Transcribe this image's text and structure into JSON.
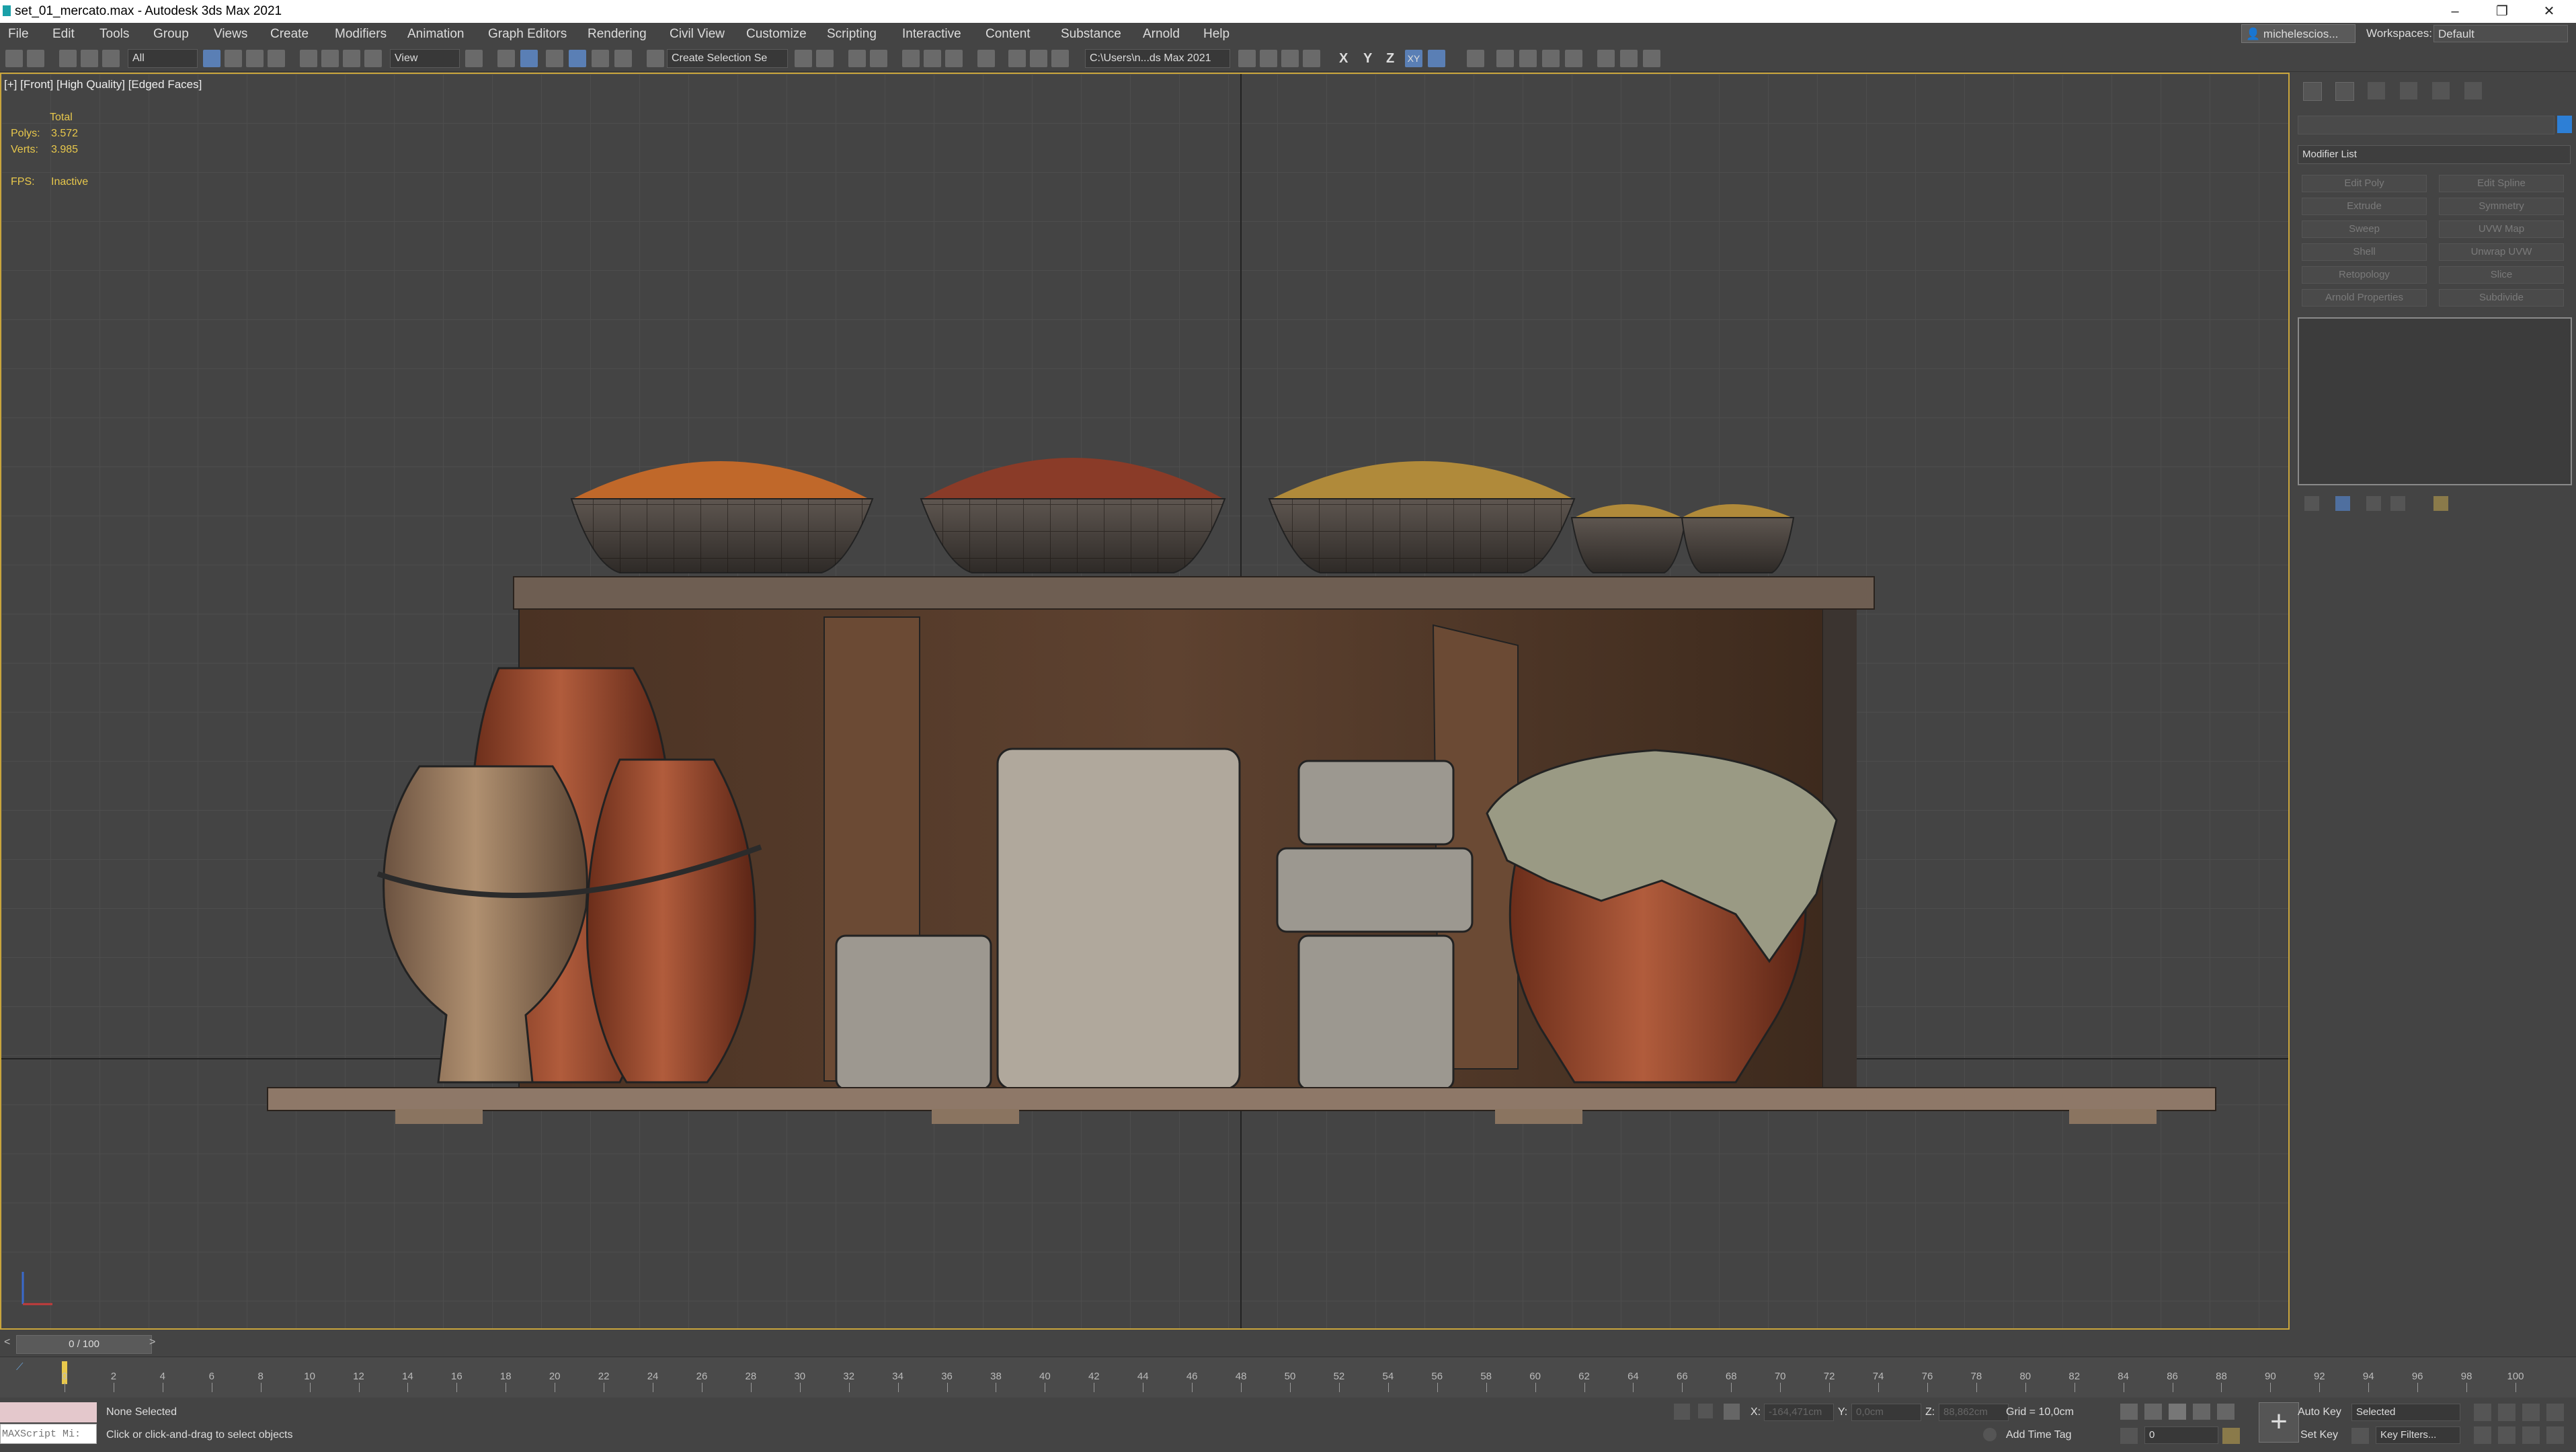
{
  "window": {
    "title": "set_01_mercato.max - Autodesk 3ds Max 2021",
    "minimize": "–",
    "restore": "❐",
    "close": "✕"
  },
  "menu": {
    "items": [
      "File",
      "Edit",
      "Tools",
      "Group",
      "Views",
      "Create",
      "Modifiers",
      "Animation",
      "Graph Editors",
      "Rendering",
      "Civil View",
      "Customize",
      "Scripting",
      "Interactive",
      "Content",
      "Substance",
      "Arnold",
      "Help"
    ],
    "user": "michelescios...",
    "workspaces_label": "Workspaces:",
    "workspace_value": "Default"
  },
  "toolbar": {
    "selection_filter": "All",
    "reference_coord": "View",
    "named_selection": "Create Selection Se",
    "project_path": "C:\\Users\\n...ds Max 2021",
    "axis_x": "X",
    "axis_y": "Y",
    "axis_z": "Z",
    "axis_xy": "XY"
  },
  "viewport": {
    "label": "[+] [Front] [High Quality] [Edged Faces]",
    "stats_total": "Total",
    "polys_label": "Polys:",
    "polys_value": "3.572",
    "verts_label": "Verts:",
    "verts_value": "3.985",
    "fps_label": "FPS:",
    "fps_value": "Inactive"
  },
  "command_panel": {
    "modifier_list": "Modifier List",
    "buttons": [
      "Edit Poly",
      "Edit Spline",
      "Extrude",
      "Symmetry",
      "Sweep",
      "UVW Map",
      "Shell",
      "Unwrap UVW",
      "Retopology",
      "Slice",
      "Arnold Properties",
      "Subdivide"
    ]
  },
  "timeline": {
    "frame_display": "0 / 100",
    "prev": "<",
    "next": ">",
    "ticks": [
      0,
      2,
      4,
      6,
      8,
      10,
      12,
      14,
      16,
      18,
      20,
      22,
      24,
      26,
      28,
      30,
      32,
      34,
      36,
      38,
      40,
      42,
      44,
      46,
      48,
      50,
      52,
      54,
      56,
      58,
      60,
      62,
      64,
      66,
      68,
      70,
      72,
      74,
      76,
      78,
      80,
      82,
      84,
      86,
      88,
      90,
      92,
      94,
      96,
      98,
      100
    ]
  },
  "status": {
    "maxscript_placeholder": "MAXScript Mi:",
    "selection": "None Selected",
    "prompt": "Click or click-and-drag to select objects",
    "x_label": "X:",
    "x_value": "-164,471cm",
    "y_label": "Y:",
    "y_value": "0,0cm",
    "z_label": "Z:",
    "z_value": "88,862cm",
    "grid": "Grid = 10,0cm",
    "add_time_tag": "Add Time Tag",
    "auto_key": "Auto Key",
    "set_key": "Set Key",
    "key_mode": "Selected",
    "key_filters": "Key Filters...",
    "current_frame": "0"
  },
  "colors": {
    "viewport_border": "#c9a53c",
    "stats_text": "#e8c84c",
    "active_button": "#5a7fb5"
  }
}
